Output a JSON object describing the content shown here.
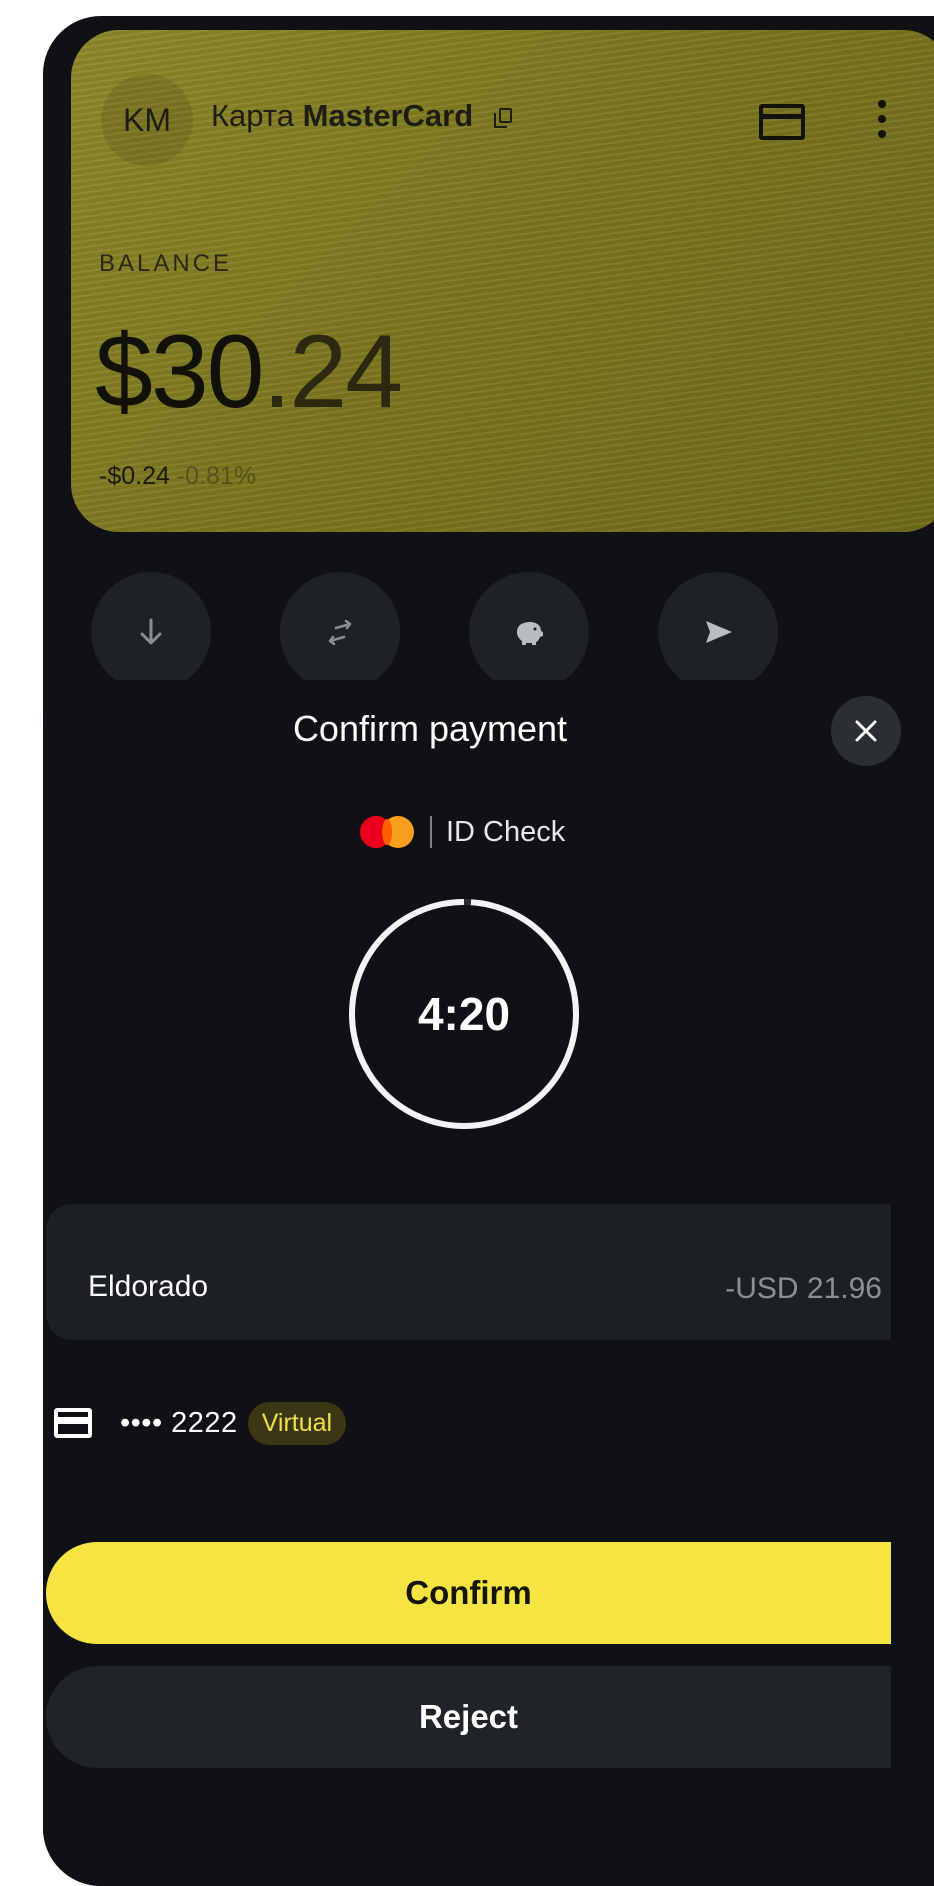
{
  "card": {
    "avatar_initials": "KM",
    "title_prefix": "Карта",
    "title_brand": "MasterCard",
    "balance_label": "BALANCE",
    "balance_main": "$30",
    "balance_cents": ".24",
    "change_amount": "-$0.24",
    "change_percent": "-0.81%",
    "background_color": "#837d22"
  },
  "actions": [
    {
      "icon": "arrow-down-icon"
    },
    {
      "icon": "transfer-arrows-icon"
    },
    {
      "icon": "piggy-bank-icon"
    },
    {
      "icon": "send-icon"
    }
  ],
  "sheet": {
    "title": "Confirm payment",
    "id_check_label": "ID Check",
    "timer_text": "4:20",
    "timer_remaining_fraction": 0.99,
    "merchant_name": "Eldorado",
    "amount": "-USD 21.96",
    "card_masked": "•••• 2222",
    "card_badge": "Virtual",
    "confirm_label": "Confirm",
    "reject_label": "Reject"
  },
  "colors": {
    "accent_yellow": "#f6e443",
    "background": "#0f1114",
    "surface": "#1c1f23"
  }
}
